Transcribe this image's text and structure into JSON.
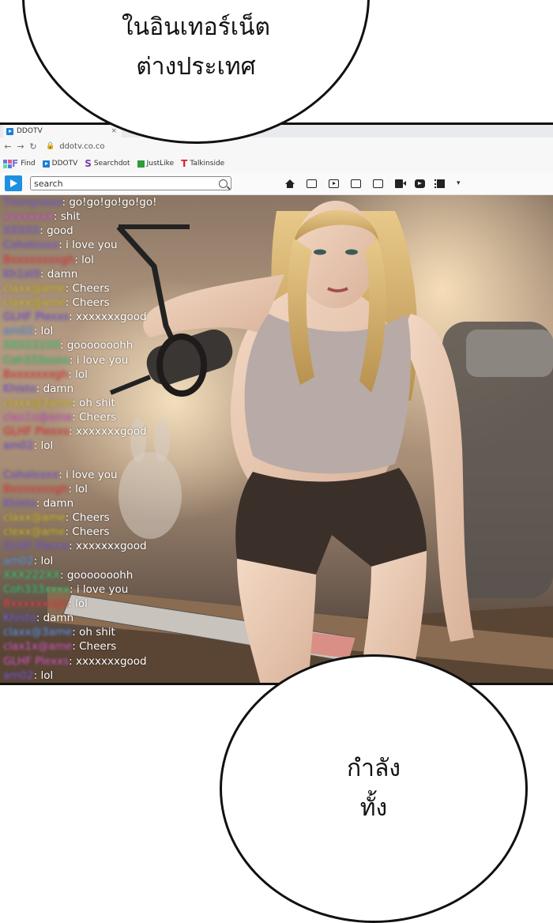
{
  "bubbles": {
    "top": {
      "line1": "ในอินเทอร์เน็ต",
      "line2": "ต่างประเทศ"
    },
    "bottom": {
      "line1": "กำลัง",
      "line2": "ทั้ง"
    }
  },
  "browser": {
    "tab_title": "DDOTV",
    "tab_close": "×",
    "nav_back": "←",
    "nav_forward": "→",
    "nav_reload": "↻",
    "url": "ddotv.co.co",
    "bookmarks": [
      {
        "label": "Find"
      },
      {
        "label": "DDOTV"
      },
      {
        "label": "Searchdot"
      },
      {
        "label": "JustLike"
      },
      {
        "label": "Talkinside"
      }
    ],
    "search_placeholder": "search",
    "menu_chevron": "▾"
  },
  "colors": {
    "user_purple": "#8a6cf0",
    "user_yellow": "#e7cf3a",
    "user_green": "#3fe07f",
    "user_pink": "#e86ad9",
    "user_red": "#ff5050",
    "user_blue": "#6fa8ff"
  },
  "chat": [
    {
      "user": "Tmmyxxxx",
      "color": "user_purple",
      "text": "go!go!go!go!go!"
    },
    {
      "user": "xxxxxxxx",
      "color": "user_pink",
      "text": "shit"
    },
    {
      "user": "XXXXX",
      "color": "user_purple",
      "text": "good"
    },
    {
      "user": "Coholxxxx",
      "color": "user_purple",
      "text": "i love you"
    },
    {
      "user": "Bxxxxxxxxgh",
      "color": "user_red",
      "text": "lol"
    },
    {
      "user": "Kh1st0",
      "color": "user_purple",
      "text": "damn"
    },
    {
      "user": "claxx@ame",
      "color": "user_yellow",
      "text": "Cheers"
    },
    {
      "user": "claxx@ame",
      "color": "user_yellow",
      "text": "Cheers"
    },
    {
      "user": "GLHF Plexxs",
      "color": "user_purple",
      "text": "xxxxxxxgood"
    },
    {
      "user": "am02",
      "color": "user_blue",
      "text": "lol"
    },
    {
      "user": "XXX222XX",
      "color": "user_green",
      "text": "gooooooohh"
    },
    {
      "user": "Coh333xxxx",
      "color": "user_green",
      "text": "i love you"
    },
    {
      "user": "Bxxxxxxxgh",
      "color": "user_red",
      "text": "lol"
    },
    {
      "user": "Khisto",
      "color": "user_purple",
      "text": "damn"
    },
    {
      "user": "claxx@3ame",
      "color": "user_yellow",
      "text": "oh shit"
    },
    {
      "user": "clax1x@ame",
      "color": "user_pink",
      "text": "Cheers"
    },
    {
      "user": "GLHF Plexxs",
      "color": "user_red",
      "text": "xxxxxxxgood"
    },
    {
      "user": "am02",
      "color": "user_purple",
      "text": "lol"
    },
    {
      "user": "",
      "color": "user_purple",
      "text": ""
    },
    {
      "user": "Coholxxxx",
      "color": "user_purple",
      "text": "i love you"
    },
    {
      "user": "Bxxxxxxxgh",
      "color": "user_red",
      "text": "lol"
    },
    {
      "user": "Khisto",
      "color": "user_purple",
      "text": "damn"
    },
    {
      "user": "claxx@ame",
      "color": "user_yellow",
      "text": "Cheers"
    },
    {
      "user": "clexx@ame",
      "color": "user_yellow",
      "text": "Cheers"
    },
    {
      "user": "GLHF Plexxs",
      "color": "user_purple",
      "text": "xxxxxxxgood"
    },
    {
      "user": "am02",
      "color": "user_blue",
      "text": "lol"
    },
    {
      "user": "XXX222XX",
      "color": "user_green",
      "text": "gooooooohh"
    },
    {
      "user": "Coh333xxxx",
      "color": "user_green",
      "text": "i love you"
    },
    {
      "user": "Bxxxxxxxgh",
      "color": "user_red",
      "text": "lol"
    },
    {
      "user": "Khisto",
      "color": "user_purple",
      "text": "damn"
    },
    {
      "user": "claxx@3ame",
      "color": "user_blue",
      "text": "oh shit"
    },
    {
      "user": "clax1x@ame",
      "color": "user_pink",
      "text": "Cheers"
    },
    {
      "user": "GLHF Plexxs",
      "color": "user_pink",
      "text": "xxxxxxxgood"
    },
    {
      "user": "am02",
      "color": "user_purple",
      "text": "lol"
    }
  ]
}
